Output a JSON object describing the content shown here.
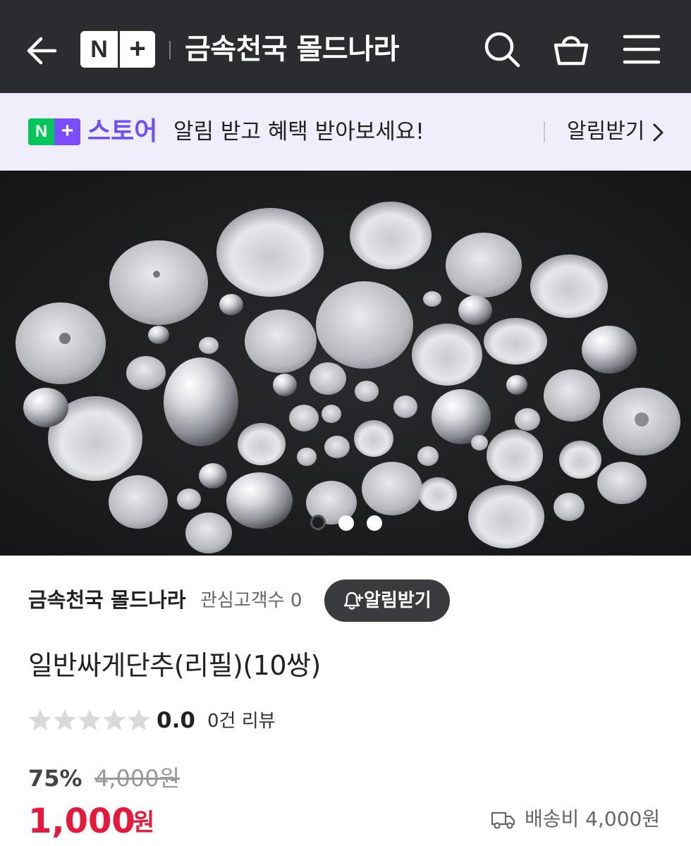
{
  "header": {
    "back_icon": "back-arrow-icon",
    "logo_n": "N",
    "logo_plus": "+",
    "title": "금속천국 몰드나라",
    "search_icon": "search-icon",
    "cart_icon": "shopping-bag-icon",
    "menu_icon": "hamburger-menu-icon"
  },
  "banner": {
    "badge_n": "N",
    "badge_plus": "+",
    "store_word": "스토어",
    "message": "알림 받고 혜택 받아보세요!",
    "cta_label": "알림받기",
    "cta_icon": "chevron-right-icon"
  },
  "carousel": {
    "image_subject": "metal-button-covers-photo",
    "slide_count": 3,
    "active_index": 0
  },
  "seller": {
    "name": "금속천국 몰드나라",
    "fans_label": "관심고객수 0",
    "alert_button_label": "알림받기",
    "alert_icon": "bell-plus-icon"
  },
  "product": {
    "title": "일반싸게단추(리필)(10쌍)",
    "rating_score": "0.0",
    "rating_stars": 0,
    "rating_max": 5,
    "review_count": "0건 리뷰"
  },
  "price": {
    "discount": "75%",
    "original": "4,000원",
    "sale": "1,000",
    "sale_unit": "원",
    "shipping": "배송비 4,000원",
    "shipping_icon": "delivery-truck-icon"
  },
  "colors": {
    "header_bg": "#2b2c2f",
    "banner_bg": "#f0eefb",
    "naver_green": "#03c75a",
    "plus_purple": "#7c4dff",
    "store_word": "#6b4eff",
    "sale_red": "#e8183c"
  }
}
